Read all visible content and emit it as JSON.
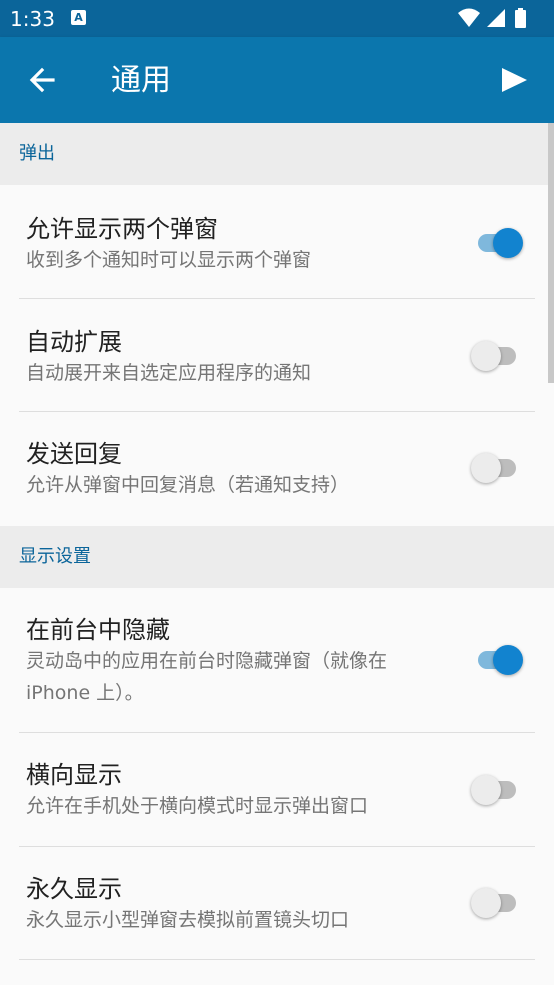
{
  "status_bar": {
    "time": "1:33",
    "notification_badge": "A",
    "icons": [
      "wifi-icon",
      "signal-icon",
      "battery-icon"
    ]
  },
  "toolbar": {
    "title": "通用",
    "back_icon": "arrow-left-icon",
    "action_icon": "play-icon"
  },
  "colors": {
    "status_bar": "#0b659a",
    "toolbar": "#0b76ad",
    "accent": "#1283cf",
    "section_background": "#ececec"
  },
  "sections": [
    {
      "header": "弹出",
      "items": [
        {
          "title": "允许显示两个弹窗",
          "summary": "收到多个通知时可以显示两个弹窗",
          "enabled": true
        },
        {
          "title": "自动扩展",
          "summary": "自动展开来自选定应用程序的通知",
          "enabled": false
        },
        {
          "title": "发送回复",
          "summary": "允许从弹窗中回复消息（若通知支持）",
          "enabled": false
        }
      ]
    },
    {
      "header": "显示设置",
      "items": [
        {
          "title": "在前台中隐藏",
          "summary": "灵动岛中的应用在前台时隐藏弹窗（就像在 iPhone 上）。",
          "enabled": true
        },
        {
          "title": "横向显示",
          "summary": "允许在手机处于横向模式时显示弹出窗口",
          "enabled": false
        },
        {
          "title": "永久显示",
          "summary": "永久显示小型弹窗去模拟前置镜头切口",
          "enabled": false
        }
      ]
    }
  ]
}
